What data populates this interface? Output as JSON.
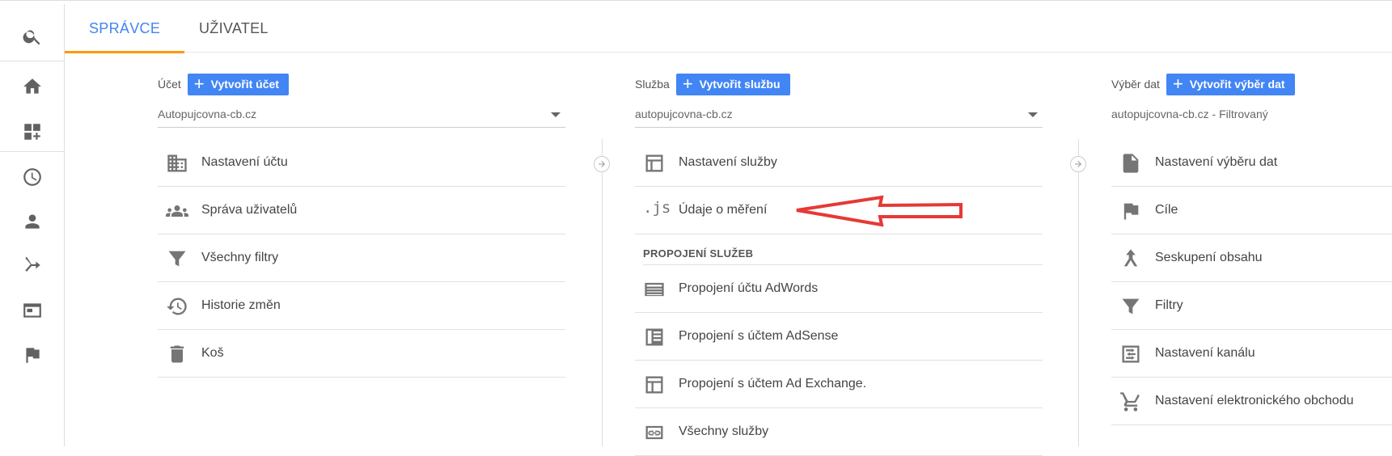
{
  "left_nav": {
    "items": [
      {
        "name": "search-icon"
      },
      {
        "name": "home-icon"
      },
      {
        "name": "dashboard-add-icon"
      },
      {
        "name": "clock-icon"
      },
      {
        "name": "person-icon"
      },
      {
        "name": "acquisition-icon"
      },
      {
        "name": "behavior-icon"
      },
      {
        "name": "flag-icon"
      }
    ]
  },
  "tabs": {
    "admin": "SPRÁVCE",
    "user": "UŽIVATEL"
  },
  "account": {
    "label": "Účet",
    "create_button": "Vytvořit účet",
    "selected": "Autopujcovna-cb.cz",
    "items": [
      {
        "label": "Nastavení účtu",
        "icon": "building-icon"
      },
      {
        "label": "Správa uživatelů",
        "icon": "people-icon"
      },
      {
        "label": "Všechny filtry",
        "icon": "filter-icon"
      },
      {
        "label": "Historie změn",
        "icon": "history-icon"
      },
      {
        "label": "Koš",
        "icon": "trash-icon"
      }
    ]
  },
  "property": {
    "label": "Služba",
    "create_button": "Vytvořit službu",
    "selected": "autopujcovna-cb.cz",
    "items": [
      {
        "label": "Nastavení služby",
        "icon": "property-settings-icon"
      },
      {
        "label": "Údaje o měření",
        "icon": "js-icon"
      }
    ],
    "section_title": "PROPOJENÍ SLUŽEB",
    "link_items": [
      {
        "label": "Propojení účtu AdWords",
        "icon": "adwords-icon"
      },
      {
        "label": "Propojení s účtem AdSense",
        "icon": "adsense-icon"
      },
      {
        "label": "Propojení s účtem Ad Exchange.",
        "icon": "ad-exchange-icon"
      },
      {
        "label": "Všechny služby",
        "icon": "link-icon"
      }
    ]
  },
  "view": {
    "label": "Výběr dat",
    "create_button": "Vytvořit výběr dat",
    "selected": "autopujcovna-cb.cz - Filtrovaný",
    "items": [
      {
        "label": "Nastavení výběru dat",
        "icon": "document-icon"
      },
      {
        "label": "Cíle",
        "icon": "flag-icon"
      },
      {
        "label": "Seskupení obsahu",
        "icon": "content-grouping-icon"
      },
      {
        "label": "Filtry",
        "icon": "filter-icon"
      },
      {
        "label": "Nastavení kanálu",
        "icon": "channel-settings-icon"
      },
      {
        "label": "Nastavení elektronického obchodu",
        "icon": "cart-icon"
      }
    ]
  },
  "colors": {
    "accent_blue": "#4285f4",
    "tab_underline": "#ff9800",
    "annotation_red": "#e53935"
  }
}
